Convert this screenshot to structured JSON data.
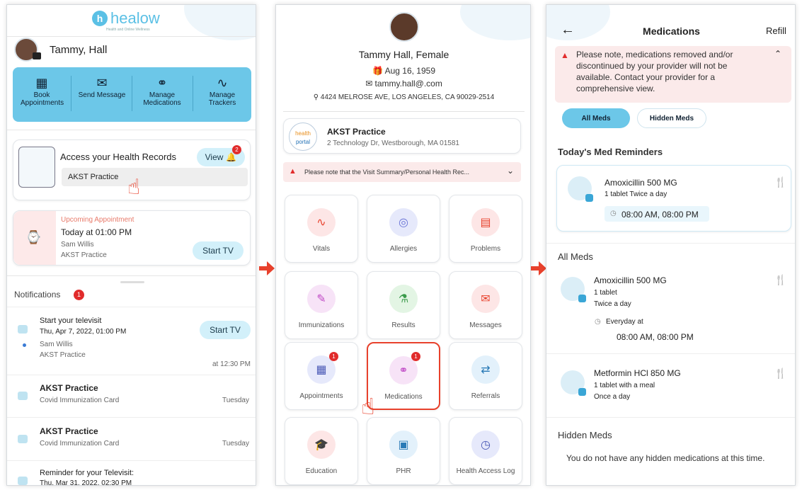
{
  "p1": {
    "logo": "healow",
    "logo_sub": "Health and Online Wellness",
    "user_name": "Tammy, Hall",
    "quick_actions": [
      "Book Appointments",
      "Send Message",
      "Manage Medications",
      "Manage Trackers"
    ],
    "records_title": "Access your Health Records",
    "view_label": "View",
    "records_badge": "2",
    "practice": "AKST Practice",
    "appt_upcoming": "Upcoming Appointment",
    "appt_time": "Today at 01:00 PM",
    "appt_provider": "Sam Willis",
    "appt_practice": "AKST Practice",
    "start_tv": "Start TV",
    "notifications_label": "Notifications",
    "notifications_count": "1",
    "notifications": [
      {
        "title": "Start your televisit",
        "sub": "Thu, Apr 7, 2022, 01:00 PM",
        "line3": "Sam Willis",
        "line4": "AKST Practice",
        "time": "at 12:30 PM",
        "action": "Start TV"
      },
      {
        "title": "AKST Practice",
        "sub": "Covid Immunization Card",
        "time": "Tuesday"
      },
      {
        "title": "AKST Practice",
        "sub": "Covid Immunization Card",
        "time": "Tuesday"
      },
      {
        "title": "Reminder for your Televisit:",
        "sub": "Thu, Mar 31, 2022, 02:30 PM"
      }
    ]
  },
  "p2": {
    "name": "Tammy Hall, Female",
    "dob": "Aug 16, 1959",
    "email": "tammy.hall@.com",
    "address": "4424 MELROSE AVE, LOS ANGELES, CA 90029-2514",
    "practice_logo_a": "health",
    "practice_logo_b": "portal",
    "practice_name": "AKST Practice",
    "practice_address": "2 Technology Dr, Westborough, MA 01581",
    "notice": "Please note that the Visit Summary/Personal Health Rec...",
    "tiles": [
      "Vitals",
      "Allergies",
      "Problems",
      "Immunizations",
      "Results",
      "Messages",
      "Appointments",
      "Medications",
      "Referrals",
      "Education",
      "PHR",
      "Health Access Log"
    ],
    "appointments_badge": "1",
    "medications_badge": "1"
  },
  "p3": {
    "title": "Medications",
    "refill": "Refill",
    "alert": "Please note, medications removed and/or discontinued by your provider will not be available. Contact your provider for a comprehensive view.",
    "tab_all": "All Meds",
    "tab_hidden": "Hidden Meds",
    "reminders_heading": "Today's Med Reminders",
    "reminder": {
      "name": "Amoxicillin 500 MG",
      "dose": "1 tablet Twice a day",
      "times": "08:00 AM, 08:00 PM"
    },
    "all_heading": "All Meds",
    "meds": [
      {
        "name": "Amoxicillin 500 MG",
        "line1": "1 tablet",
        "line2": "Twice a day",
        "schedule": "Everyday at",
        "times": "08:00 AM, 08:00 PM"
      },
      {
        "name": "Metformin HCl 850 MG",
        "line1": "1 tablet with a meal",
        "line2": "Once a day"
      }
    ],
    "hidden_heading": "Hidden Meds",
    "hidden_empty": "You do not have any hidden medications at this time."
  },
  "colors": {
    "accent": "#5bc0e5",
    "teal_bar": "#6cc7e8",
    "badge": "#e12c2c",
    "arrow": "#e8412c"
  }
}
